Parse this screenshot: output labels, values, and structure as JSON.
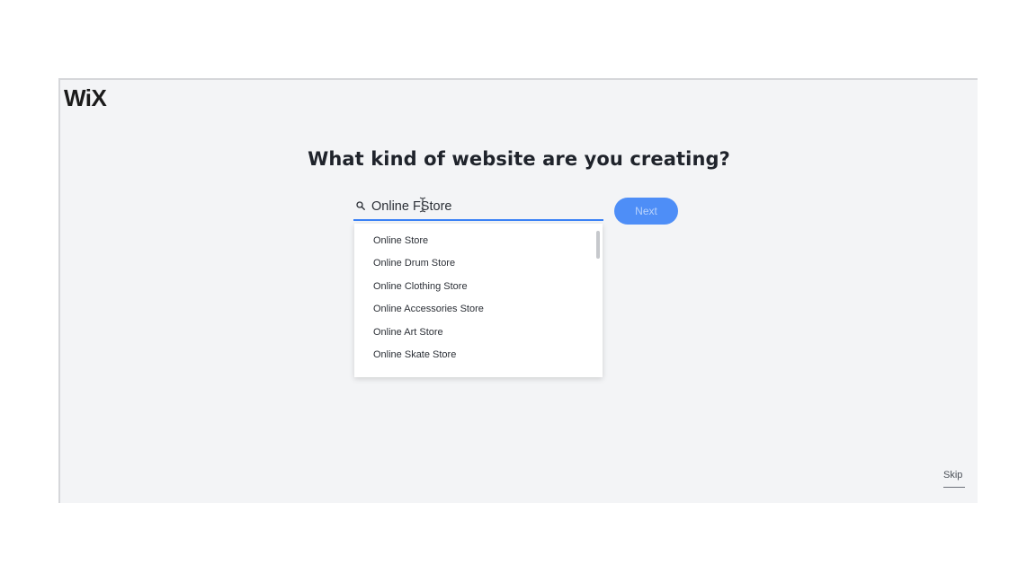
{
  "app": {
    "logo": "WiX"
  },
  "main": {
    "title": "What kind of website are you creating?"
  },
  "search": {
    "value": "Online FStore",
    "icon": "search-icon"
  },
  "next_button": {
    "label": "Next"
  },
  "dropdown": {
    "options": [
      "Online Store",
      "Online Drum Store",
      "Online Clothing Store",
      "Online Accessories Store",
      "Online Art Store",
      "Online Skate Store"
    ]
  },
  "footer": {
    "skip_label": "Skip"
  },
  "colors": {
    "accent": "#3b82f6",
    "button": "#4e8ef7",
    "background": "#f3f4f6"
  }
}
